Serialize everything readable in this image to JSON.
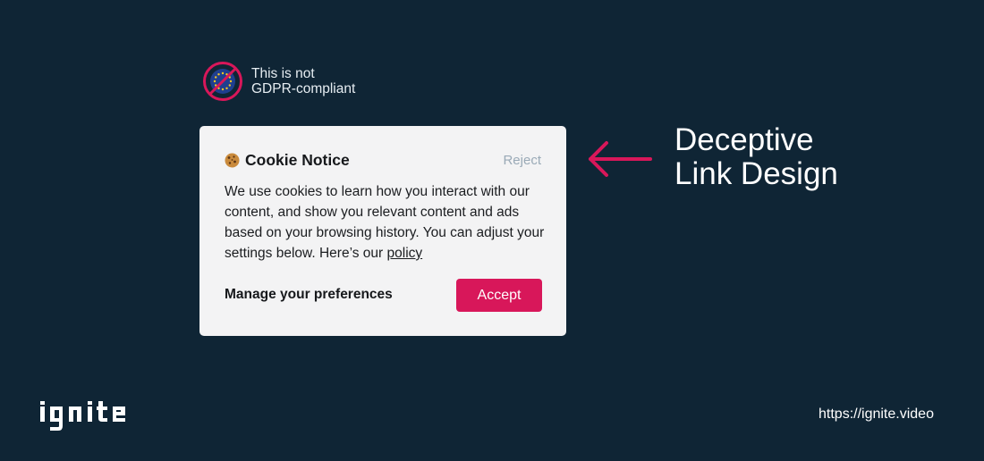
{
  "gdpr": {
    "line1": "This is not",
    "line2": "GDPR-compliant",
    "icon": "eu-flag-prohibited-icon"
  },
  "cookie_notice": {
    "title": "Cookie Notice",
    "reject_label": "Reject",
    "body": "We use cookies to learn how you interact with our content, and show you relevant content and ads based on your browsing history. You can adjust your settings below. Here’s our ",
    "policy_link": "policy",
    "manage_label": "Manage your preferences",
    "accept_label": "Accept"
  },
  "annotation": {
    "line1": "Deceptive",
    "line2": "Link Design"
  },
  "footer": {
    "logo": "ignite",
    "url": "https://ignite.video"
  },
  "colors": {
    "background": "#0f2535",
    "accent": "#d8175a",
    "card": "#f3f3f4",
    "muted_link": "#9aaab7",
    "eu_blue": "#1f3f8f",
    "eu_star": "#f3c623"
  }
}
